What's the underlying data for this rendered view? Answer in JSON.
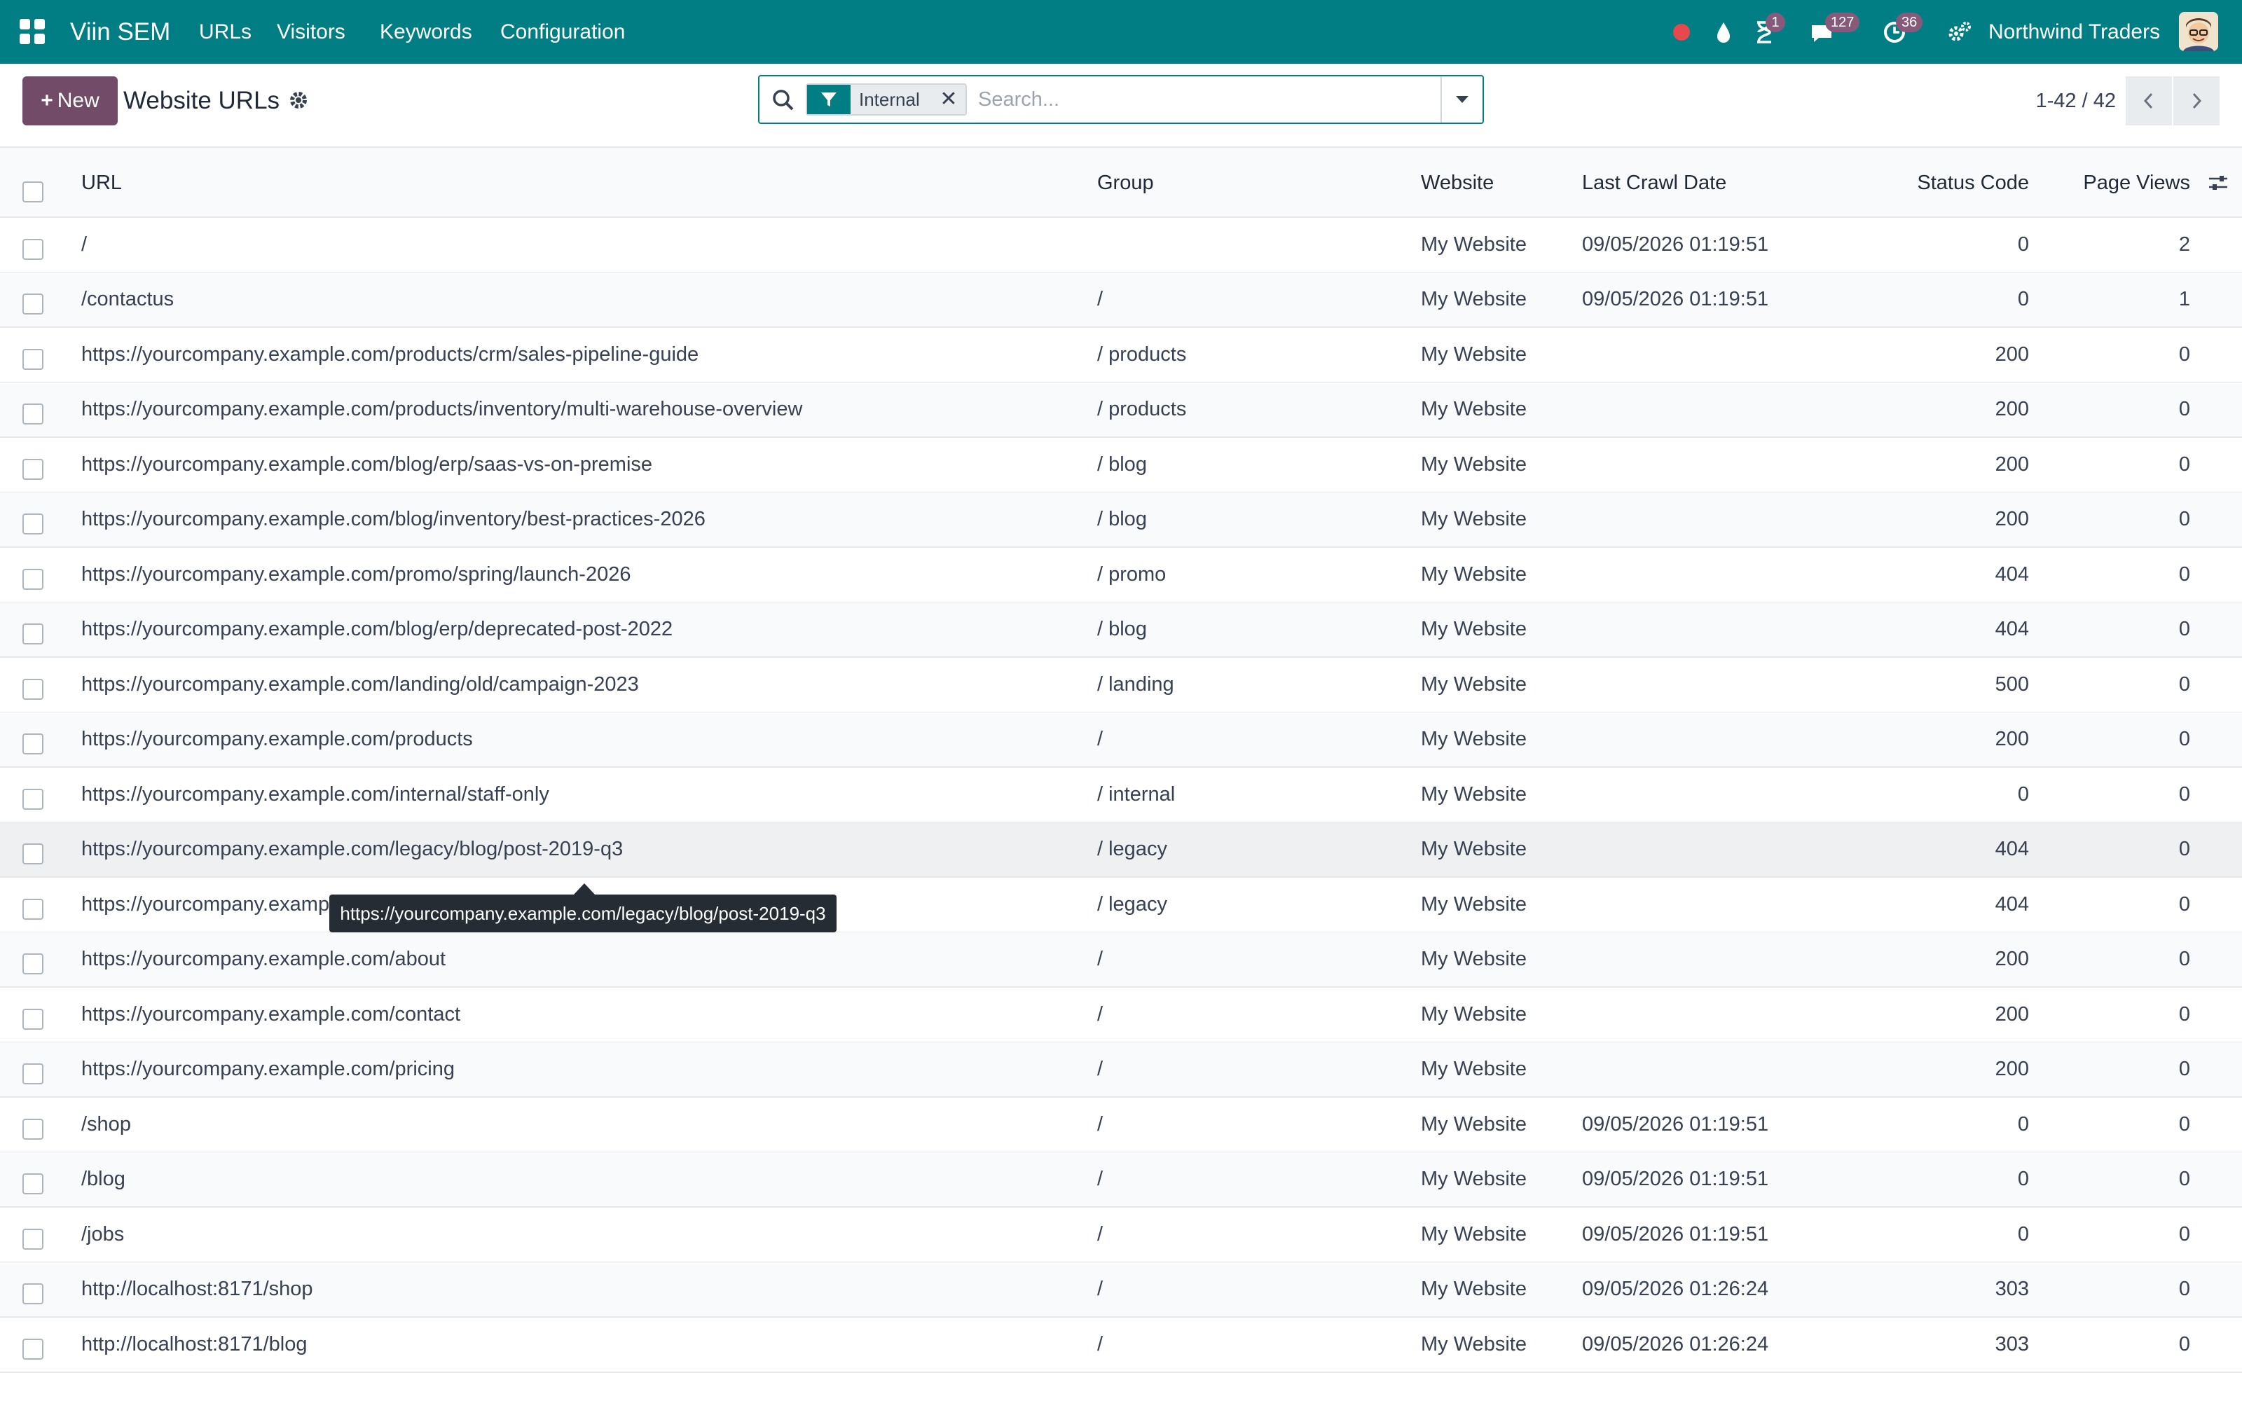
{
  "navbar": {
    "app_name": "Viin SEM",
    "menu": [
      "URLs",
      "Visitors",
      "Keywords",
      "Configuration"
    ],
    "badges": {
      "activities": "1",
      "messages": "127",
      "clock": "36"
    },
    "company": "Northwind Traders"
  },
  "control": {
    "new_label": "New",
    "title": "Website URLs",
    "facet_label": "Internal",
    "search_placeholder": "Search...",
    "pager": "1-42 / 42"
  },
  "columns": [
    "URL",
    "Group",
    "Website",
    "Last Crawl Date",
    "Status Code",
    "Page Views"
  ],
  "rows": [
    {
      "url": "/",
      "group": "",
      "website": "My Website",
      "date": "09/05/2026 01:19:51",
      "status": "0",
      "views": "2"
    },
    {
      "url": "/contactus",
      "group": "/",
      "website": "My Website",
      "date": "09/05/2026 01:19:51",
      "status": "0",
      "views": "1"
    },
    {
      "url": "https://yourcompany.example.com/products/crm/sales-pipeline-guide",
      "group": "/ products",
      "website": "My Website",
      "date": "",
      "status": "200",
      "views": "0"
    },
    {
      "url": "https://yourcompany.example.com/products/inventory/multi-warehouse-overview",
      "group": "/ products",
      "website": "My Website",
      "date": "",
      "status": "200",
      "views": "0"
    },
    {
      "url": "https://yourcompany.example.com/blog/erp/saas-vs-on-premise",
      "group": "/ blog",
      "website": "My Website",
      "date": "",
      "status": "200",
      "views": "0"
    },
    {
      "url": "https://yourcompany.example.com/blog/inventory/best-practices-2026",
      "group": "/ blog",
      "website": "My Website",
      "date": "",
      "status": "200",
      "views": "0"
    },
    {
      "url": "https://yourcompany.example.com/promo/spring/launch-2026",
      "group": "/ promo",
      "website": "My Website",
      "date": "",
      "status": "404",
      "views": "0"
    },
    {
      "url": "https://yourcompany.example.com/blog/erp/deprecated-post-2022",
      "group": "/ blog",
      "website": "My Website",
      "date": "",
      "status": "404",
      "views": "0"
    },
    {
      "url": "https://yourcompany.example.com/landing/old/campaign-2023",
      "group": "/ landing",
      "website": "My Website",
      "date": "",
      "status": "500",
      "views": "0"
    },
    {
      "url": "https://yourcompany.example.com/products",
      "group": "/",
      "website": "My Website",
      "date": "",
      "status": "200",
      "views": "0"
    },
    {
      "url": "https://yourcompany.example.com/internal/staff-only",
      "group": "/ internal",
      "website": "My Website",
      "date": "",
      "status": "0",
      "views": "0"
    },
    {
      "url": "https://yourcompany.example.com/legacy/blog/post-2019-q3",
      "group": "/ legacy",
      "website": "My Website",
      "date": "",
      "status": "404",
      "views": "0"
    },
    {
      "url": "https://yourcompany.examp",
      "group": "/ legacy",
      "website": "My Website",
      "date": "",
      "status": "404",
      "views": "0"
    },
    {
      "url": "https://yourcompany.example.com/about",
      "group": "/",
      "website": "My Website",
      "date": "",
      "status": "200",
      "views": "0"
    },
    {
      "url": "https://yourcompany.example.com/contact",
      "group": "/",
      "website": "My Website",
      "date": "",
      "status": "200",
      "views": "0"
    },
    {
      "url": "https://yourcompany.example.com/pricing",
      "group": "/",
      "website": "My Website",
      "date": "",
      "status": "200",
      "views": "0"
    },
    {
      "url": "/shop",
      "group": "/",
      "website": "My Website",
      "date": "09/05/2026 01:19:51",
      "status": "0",
      "views": "0"
    },
    {
      "url": "/blog",
      "group": "/",
      "website": "My Website",
      "date": "09/05/2026 01:19:51",
      "status": "0",
      "views": "0"
    },
    {
      "url": "/jobs",
      "group": "/",
      "website": "My Website",
      "date": "09/05/2026 01:19:51",
      "status": "0",
      "views": "0"
    },
    {
      "url": "http://localhost:8171/shop",
      "group": "/",
      "website": "My Website",
      "date": "09/05/2026 01:26:24",
      "status": "303",
      "views": "0"
    },
    {
      "url": "http://localhost:8171/blog",
      "group": "/",
      "website": "My Website",
      "date": "09/05/2026 01:26:24",
      "status": "303",
      "views": "0"
    }
  ],
  "tooltip": "https://yourcompany.example.com/legacy/blog/post-2019-q3",
  "colors": {
    "navbar": "#017e84",
    "primary_button": "#714b67",
    "badge": "#875a7b"
  }
}
